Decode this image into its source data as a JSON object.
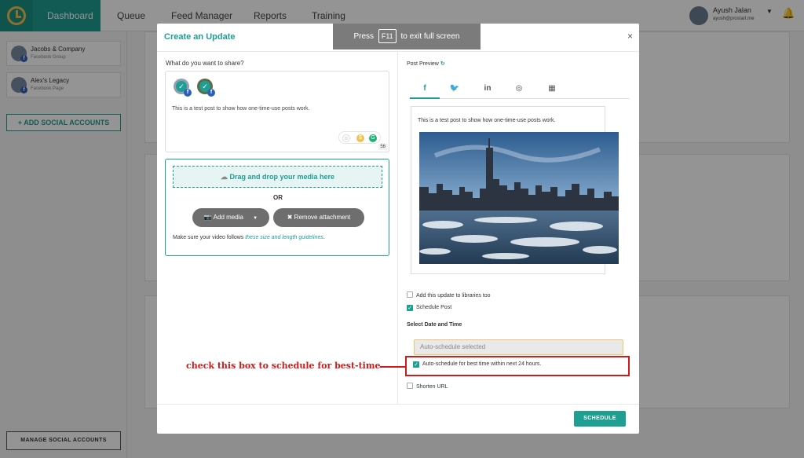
{
  "nav": {
    "tabs": [
      "Dashboard",
      "Queue",
      "Feed Manager",
      "Reports",
      "Training"
    ],
    "user_name": "Ayush Jalan",
    "user_email": "ayush@prostart.me"
  },
  "sidebar": {
    "accounts": [
      {
        "name": "Jacobs & Company",
        "type": "Facebook Group"
      },
      {
        "name": "Alex's Legacy",
        "type": "Facebook Page"
      }
    ],
    "add_social": "+ ADD SOCIAL ACCOUNTS",
    "manage_social": "MANAGE SOCIAL ACCOUNTS"
  },
  "fullscreen": {
    "press": "Press",
    "key": "F11",
    "suffix": "to exit full screen"
  },
  "modal": {
    "title": "Create an Update",
    "close": "×",
    "share_label": "What do you want to share?",
    "post_text": "This is a test post to show how one-time-use posts work.",
    "char_count": "56",
    "drop_zone": "Drag and drop your media here",
    "or": "OR",
    "add_media": "Add media",
    "remove_attachment": "Remove attachment",
    "guide_prefix": "Make sure your video follows ",
    "guide_link": "these size and length guidelines",
    "guide_suffix": ".",
    "post_preview": "Post Preview",
    "preview_text": "This is a test post to show how one-time-use posts work.",
    "checks": {
      "libraries": "Add this update to libraries too",
      "schedule_post": "Schedule Post",
      "auto_best": "Auto-schedule for best time within next 24 hours.",
      "shorten_url": "Shorten URL"
    },
    "date_time_label": "Select Date and Time",
    "auto_input": "Auto-schedule selected",
    "schedule": "SCHEDULE"
  },
  "annotation": {
    "callout": "check this box to schedule for best-time",
    "highlight_color": "#d01b1b"
  },
  "colors": {
    "accent": "#1f9e92",
    "overlay": "rgba(0,0,0,0.42)"
  }
}
